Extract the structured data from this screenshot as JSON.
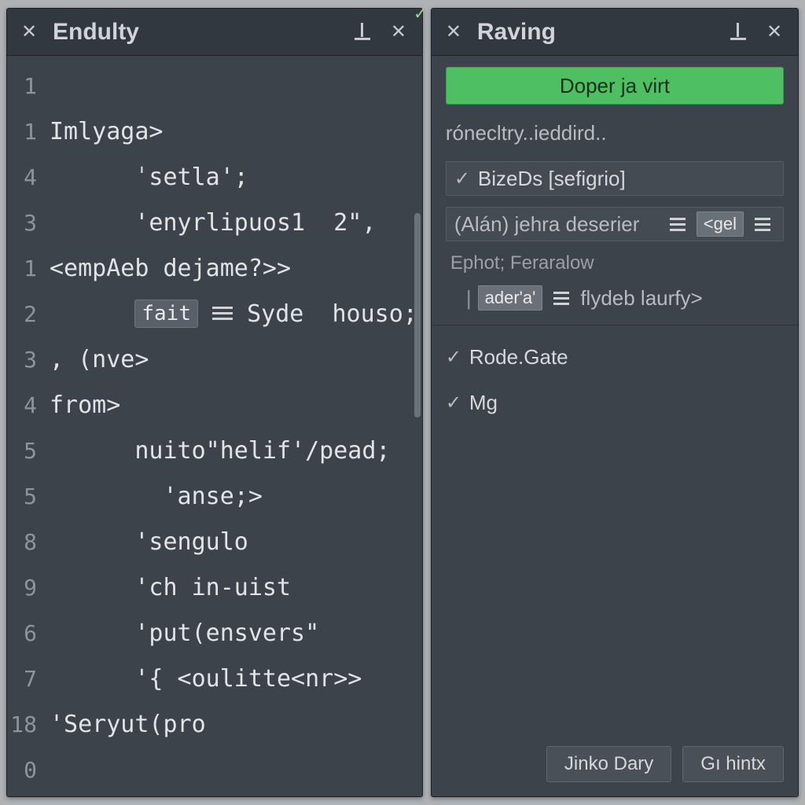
{
  "left": {
    "title": "Endulty",
    "gutter": [
      "1",
      "1",
      "4",
      "3",
      "1",
      "2",
      "3",
      "4",
      "5",
      "5",
      "8",
      "9",
      "6",
      "7",
      "18",
      "0"
    ],
    "lines": [
      "",
      "Imlyaga>",
      "      ˈsetla';",
      "      'enyrlipuos1  2\",",
      "<empAeb dejame?>>",
      "      __BADGE__:fait __BARS__ Syde  houso;",
      ", (nve>",
      "from>",
      "      nuito\"helif'/pead;",
      "        'anse;>",
      "      'sengulo",
      "      'ch in-uist",
      "      'put(ensvers\"",
      "      '{ <oulitte<nr>>",
      "'Seryut(pro",
      ""
    ]
  },
  "right": {
    "title": "Raving",
    "run_button": "Doper ja virt",
    "items": {
      "hint": "rónecltry..ieddird..",
      "opt1": "BizeDs [sefigrio]",
      "opt2_prefix": "(Alán) jehra deserier",
      "opt2_chip": "<gel",
      "section": "Ephot; Feraralow",
      "sub_pill": "ader'a'",
      "sub_text": "flydeb laurfy>",
      "opt3": "Rode.Gate",
      "opt4": "Mg"
    },
    "buttons": {
      "ok": "Jinko Dary",
      "cancel": "Gı hintx"
    }
  }
}
